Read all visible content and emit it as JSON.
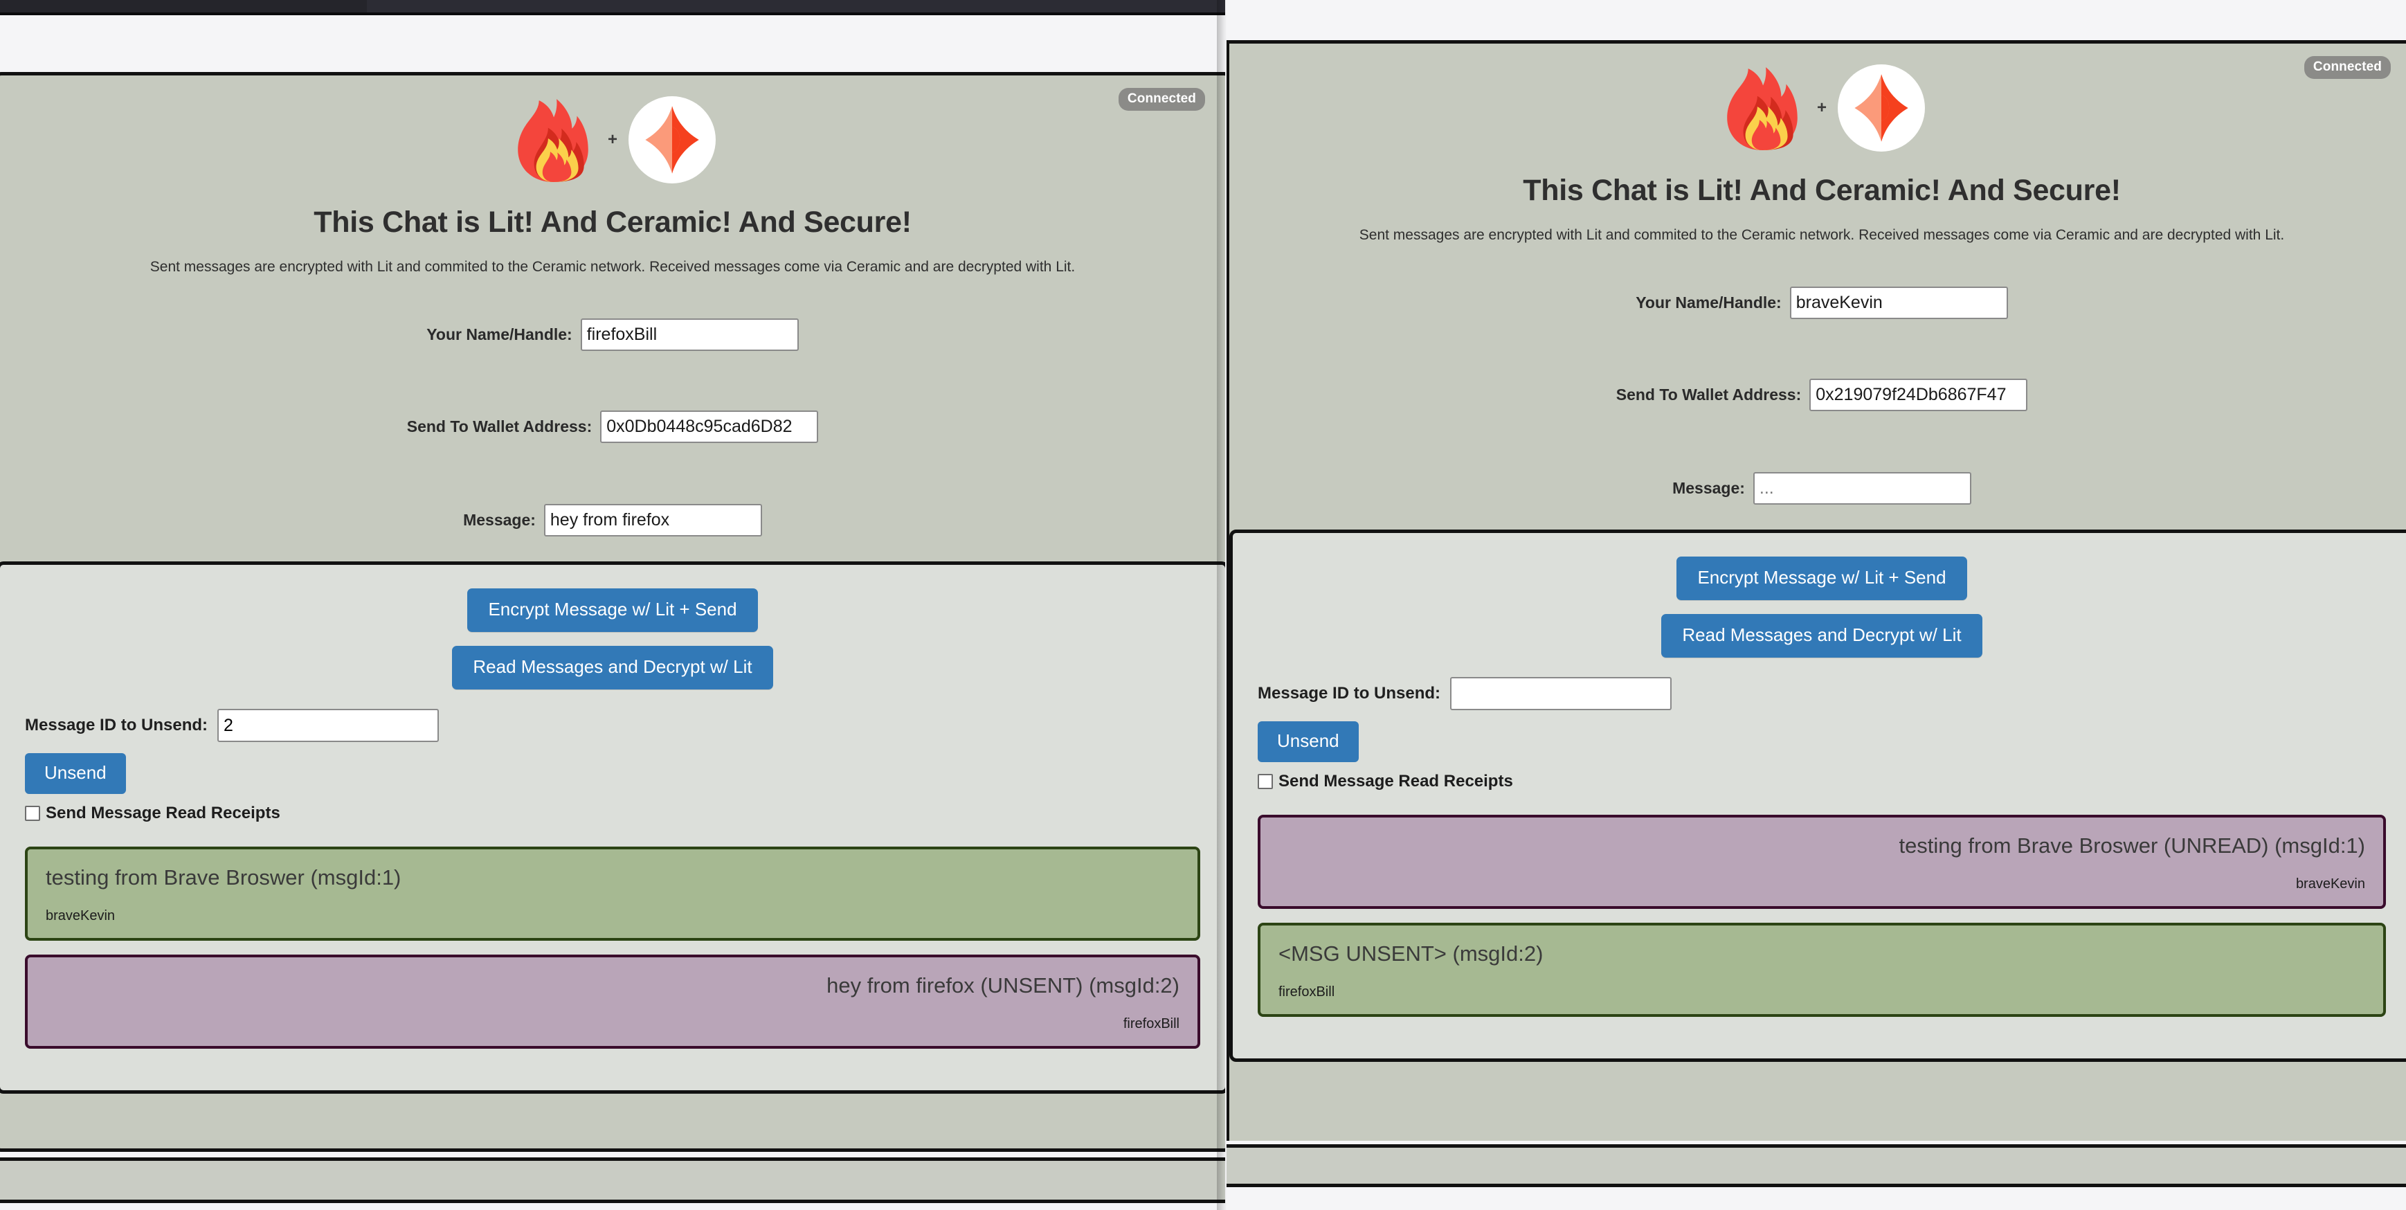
{
  "app": {
    "title": "This Chat is Lit! And Ceramic! And Secure!",
    "subtitle": "Sent messages are encrypted with Lit and commited to the Ceramic network. Received messages come via Ceramic and are decrypted with Lit.",
    "status_badge": "Connected",
    "plus": "+",
    "accent_blue": "#3279b7",
    "bubble_green": "#a6b992",
    "bubble_green_border": "#2c4414",
    "bubble_purple": "#b9a5b8",
    "bubble_purple_border": "#3a0c2c",
    "page_background": "#c6cabf",
    "panel_background": "#dcdfda",
    "badge_background": "#8b8b88"
  },
  "labels": {
    "name": "Your Name/Handle:",
    "wallet": "Send To Wallet Address:",
    "message": "Message:",
    "unsend_id": "Message ID to Unsend:",
    "read_receipts": "Send Message Read Receipts"
  },
  "buttons": {
    "encrypt_send": "Encrypt Message w/ Lit + Send",
    "read_decrypt": "Read Messages and Decrypt w/ Lit",
    "unsend": "Unsend"
  },
  "left_window": {
    "name_value": "firefoxBill",
    "name_placeholder": "",
    "wallet_value": "0x0Db0448c95cad6D82",
    "wallet_placeholder": "",
    "message_value": "hey from firefox",
    "message_placeholder": "...",
    "unsend_value": "2",
    "unsend_placeholder": "",
    "read_receipts_checked": false,
    "messages": [
      {
        "text": "testing from Brave Broswer (msgId:1)",
        "author": "braveKevin",
        "color": "green",
        "align": "left"
      },
      {
        "text": "hey from firefox (UNSENT) (msgId:2)",
        "author": "firefoxBill",
        "color": "purple",
        "align": "right"
      }
    ]
  },
  "right_window": {
    "name_value": "braveKevin",
    "name_placeholder": "",
    "wallet_value": "0x219079f24Db6867F47",
    "wallet_placeholder": "",
    "message_value": "",
    "message_placeholder": "...",
    "unsend_value": "",
    "unsend_placeholder": "",
    "read_receipts_checked": false,
    "messages": [
      {
        "text": "testing from Brave Broswer (UNREAD) (msgId:1)",
        "author": "braveKevin",
        "color": "purple",
        "align": "right"
      },
      {
        "text": "<MSG UNSENT> (msgId:2)",
        "author": "firefoxBill",
        "color": "green",
        "align": "left"
      }
    ]
  },
  "icons": {
    "flame": "fire-emoji",
    "ceramic": "ceramic-logo"
  }
}
